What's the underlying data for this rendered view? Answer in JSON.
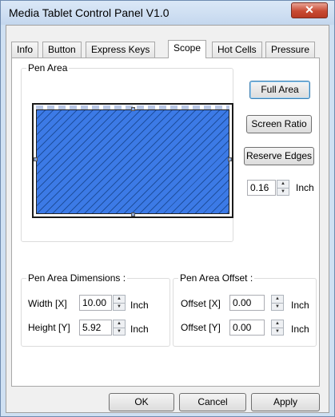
{
  "window": {
    "title": "Media Tablet Control Panel V1.0",
    "close_glyph": "✕"
  },
  "tabs": [
    {
      "label": "Info",
      "active": false
    },
    {
      "label": "Button",
      "active": false
    },
    {
      "label": "Express Keys",
      "active": false
    },
    {
      "label": "Scope",
      "active": true
    },
    {
      "label": "Hot Cells",
      "active": false
    },
    {
      "label": "Pressure",
      "active": false
    }
  ],
  "pen_area": {
    "legend": "Pen Area",
    "buttons": {
      "full_area": "Full Area",
      "screen_ratio": "Screen Ratio",
      "reserve_edges": "Reserve Edges"
    },
    "edge_value": "0.16",
    "edge_unit": "Inch"
  },
  "dimensions": {
    "legend": "Pen Area Dimensions :",
    "width_label": "Width [X]",
    "width_value": "10.00",
    "width_unit": "Inch",
    "height_label": "Height [Y]",
    "height_value": "5.92",
    "height_unit": "Inch"
  },
  "offset": {
    "legend": "Pen Area Offset :",
    "x_label": "Offset [X]",
    "x_value": "0.00",
    "x_unit": "Inch",
    "y_label": "Offset [Y]",
    "y_value": "0.00",
    "y_unit": "Inch"
  },
  "footer": {
    "ok": "OK",
    "cancel": "Cancel",
    "apply": "Apply"
  },
  "colors": {
    "pen_area_fill": "#3c7ae6",
    "title_bar": "#cfe0f2",
    "close_button": "#c84a33"
  }
}
